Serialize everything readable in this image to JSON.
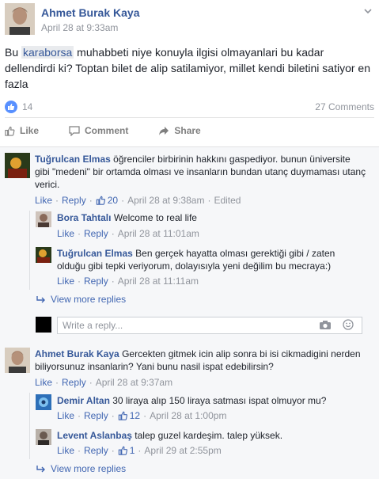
{
  "post": {
    "author": "Ahmet Burak Kaya",
    "time": "April 28 at 9:33am",
    "text_before": "Bu ",
    "tag": "karaborsa",
    "text_after": " muhabbeti niye konuyla ilgisi olmayanlari bu kadar dellendirdi ki? Toptan bilet de alip satilamiyor, millet kendi biletini satiyor en fazla",
    "likes": "14",
    "comments": "27 Comments"
  },
  "actions": {
    "like": "Like",
    "comment": "Comment",
    "share": "Share"
  },
  "labels": {
    "like": "Like",
    "reply": "Reply",
    "view_more": "View more replies",
    "write_placeholder": "Write a reply...",
    "sep": "·"
  },
  "comments": [
    {
      "author": "Tuğrulcan Elmas",
      "text": "öğrenciler birbirinin hakkını gaspediyor. bunun üniversite gibi \"medeni\" bir ortamda olması ve insanların bundan utanç duymaması utanç verici.",
      "likes": "20",
      "time": "April 28 at 9:38am",
      "edited": "Edited"
    },
    {
      "author": "Bora Tahtalı",
      "text": "Welcome to real life",
      "time": "April 28 at 11:01am"
    },
    {
      "author": "Tuğrulcan Elmas",
      "text": "Ben gerçek hayatta olması gerektiği gibi / zaten olduğu gibi tepki veriyorum, dolayısıyla yeni değilim bu mecraya:)",
      "time": "April 28 at 11:11am"
    },
    {
      "author": "Ahmet Burak Kaya",
      "text": "Gercekten gitmek icin alip sonra bi isi cikmadigini nerden biliyorsunuz insanlarin? Yani bunu nasil ispat edebilirsin?",
      "time": "April 28 at 9:37am"
    },
    {
      "author": "Demir Altan",
      "text": "30 liraya alıp 150 liraya satması ispat olmuyor mu?",
      "likes": "12",
      "time": "April 28 at 1:00pm"
    },
    {
      "author": "Levent Aslanbaş",
      "text": "talep guzel kardeşim. talep yüksek.",
      "likes": "1",
      "time": "April 29 at 2:55pm"
    }
  ],
  "colors": {
    "link": "#365899",
    "meta": "#90949c",
    "action": "#4267b2",
    "like_badge": "#5890ff"
  }
}
